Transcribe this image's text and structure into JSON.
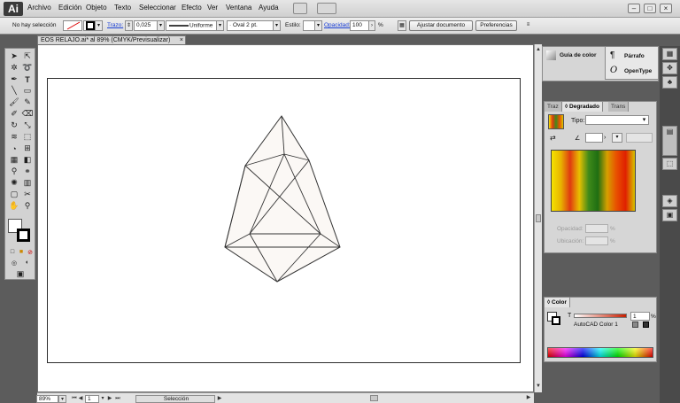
{
  "app": {
    "logo": "Ai"
  },
  "menus": [
    "Archivo",
    "Edición",
    "Objeto",
    "Texto",
    "Seleccionar",
    "Efecto",
    "Ver",
    "Ventana",
    "Ayuda"
  ],
  "window_buttons": [
    "–",
    "□",
    "×"
  ],
  "control_bar": {
    "selection_label": "No hay selección",
    "stroke_link": "Trazo:",
    "stroke_value": "0,025",
    "stroke_profile": "Uniforme",
    "brush": "Oval 2 pt.",
    "style_label": "Estilo:",
    "opacity_link": "Opacidad:",
    "opacity_value": "100",
    "percent": "%",
    "doc_setup_button": "Ajustar documento",
    "prefs_button": "Preferencias"
  },
  "document": {
    "tab_title": "EOS RELAJO.ai* al 89% (CMYK/Previsualizar)",
    "close_glyph": "×"
  },
  "status": {
    "zoom": "89%",
    "page": "1",
    "mode": "Selección"
  },
  "panels": {
    "color_guide": "Guía de color",
    "paragraph": "Párrafo",
    "opentype": "OpenType",
    "gradient": {
      "tabs": [
        "Traz",
        "◊ Degradado",
        "Trans"
      ],
      "type_label": "Tipo:",
      "opacity_label": "Opacidad:",
      "location_label": "Ubicación:",
      "percent": "%",
      "stops": [
        "#f5e200",
        "#e8b400",
        "#e03a10",
        "#e8c000",
        "#3f8a1a",
        "#1f6e12",
        "#d6a000",
        "#e85000",
        "#e02000",
        "#d8c400"
      ]
    },
    "color": {
      "tab": "◊ Color",
      "tint_label": "T",
      "tint_value": "1",
      "percent": "%",
      "swatch_name": "AutoCAD Color 1"
    }
  },
  "colors": {
    "accent_link": "#1a3fd6",
    "artwork_fill": "#fbf8f5",
    "artwork_stroke": "#333333",
    "tint_ramp_start": "#ffffff",
    "tint_ramp_end": "#c81e00"
  }
}
